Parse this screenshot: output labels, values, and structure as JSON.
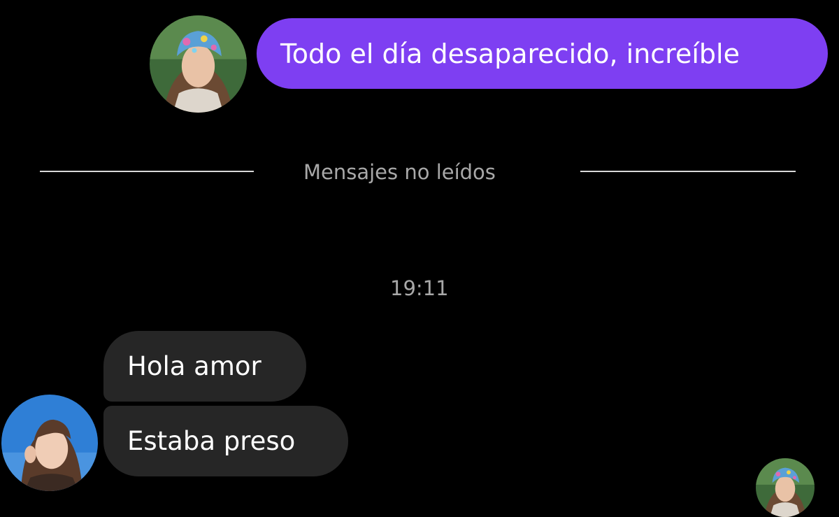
{
  "conversation": {
    "outgoing": {
      "text": "Todo el día desaparecido, increíble"
    },
    "unread_divider": {
      "label": "Mensajes no leídos"
    },
    "timestamp": "19:11",
    "incoming": [
      {
        "text": "Hola amor"
      },
      {
        "text": "Estaba preso"
      }
    ]
  },
  "colors": {
    "background": "#000000",
    "outgoing_bubble": "#7e3ff2",
    "incoming_bubble": "#262626",
    "meta_text": "#a8a8a8"
  },
  "icons": {
    "sender_avatar": "profile-photo-bandana",
    "contact_avatar": "profile-photo",
    "read_receipt_avatar": "profile-photo-bandana"
  }
}
